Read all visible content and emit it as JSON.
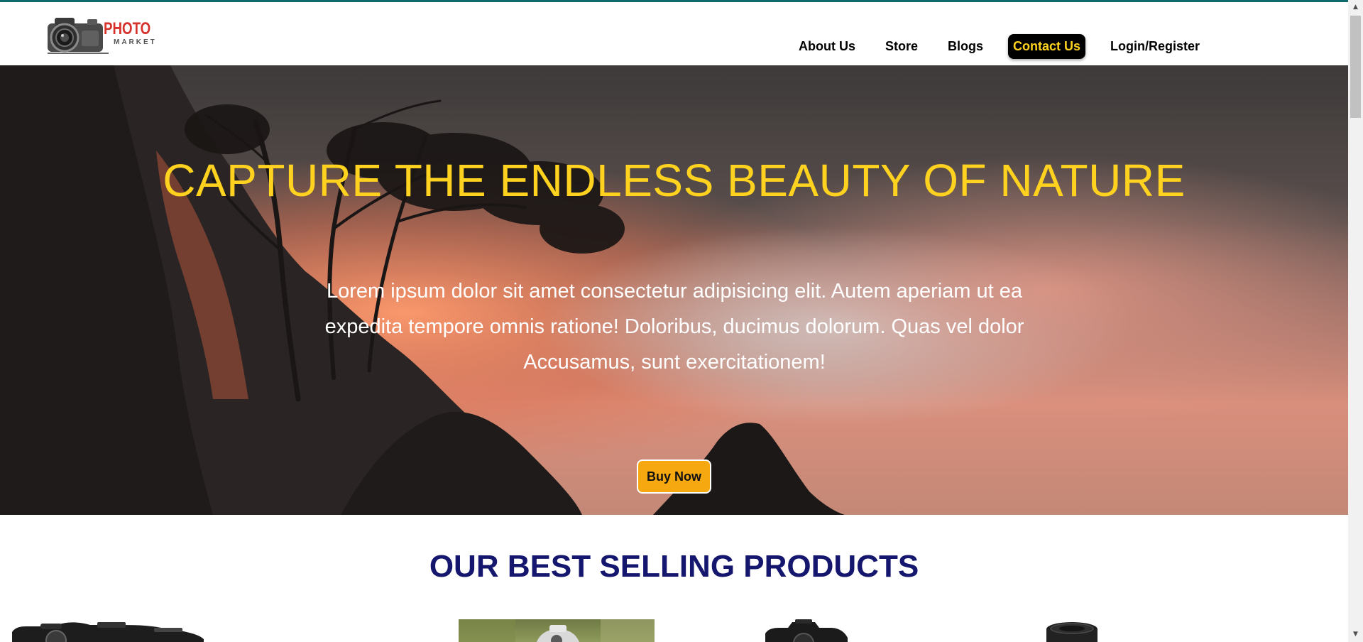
{
  "header": {
    "logo": {
      "word1": "PHOTO",
      "word2": "MARKET"
    },
    "nav": [
      {
        "label": "About Us",
        "active": false
      },
      {
        "label": "Store",
        "active": false
      },
      {
        "label": "Blogs",
        "active": false
      },
      {
        "label": "Contact Us",
        "active": true
      },
      {
        "label": "Login/Register",
        "active": false
      }
    ]
  },
  "hero": {
    "title": "CAPTURE THE ENDLESS BEAUTY OF NATURE",
    "text_line1": "Lorem ipsum dolor sit amet consectetur adipisicing elit. Autem aperiam ut ea",
    "text_line2": "expedita tempore omnis ratione! Doloribus, ducimus dolorum. Quas vel dolor",
    "text_line3": "Accusamus, sunt exercitationem!",
    "button_label": "Buy Now",
    "image_icon": "sunset-landscape-image"
  },
  "products": {
    "title": "OUR BEST SELLING PRODUCTS",
    "items": [
      {
        "icon": "compact-camera-image"
      },
      {
        "icon": "camera-outdoor-photo"
      },
      {
        "icon": "dslr-camera-image"
      },
      {
        "icon": "camera-lens-image"
      }
    ]
  },
  "colors": {
    "accent_yellow": "#ffd21f",
    "button_orange": "#f5a80f",
    "heading_navy": "#15166e",
    "top_border_teal": "#0f6b6b"
  }
}
